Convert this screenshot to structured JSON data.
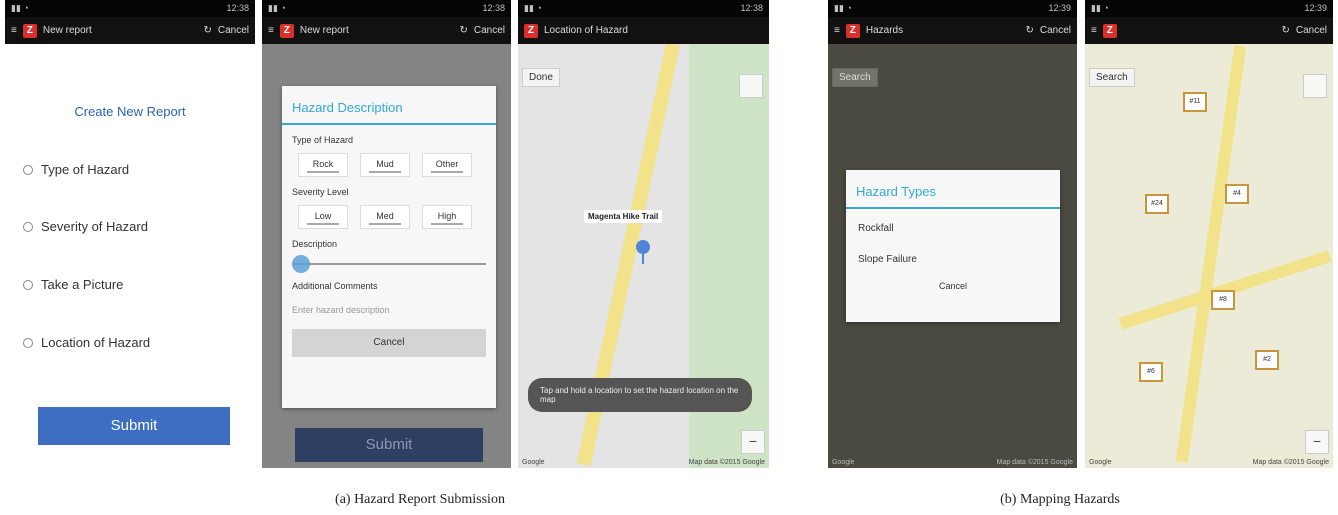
{
  "status_time": "12:38",
  "status_time_right": "12:39",
  "panels": [
    {
      "actionbar_title": "New report",
      "actionbar_right": "Cancel",
      "title": "Create New Report",
      "items": [
        "Type of Hazard",
        "Severity of Hazard",
        "Take a Picture",
        "Location of Hazard"
      ],
      "submit": "Submit"
    },
    {
      "actionbar_title": "New report",
      "actionbar_right": "Cancel",
      "dialog_title": "Hazard Description",
      "hazard_type_label": "Type of Hazard",
      "hazard_types": [
        "Rock",
        "Mud",
        "Other"
      ],
      "severity_label": "Severity Level",
      "severity_options": [
        "Low",
        "Med",
        "High"
      ],
      "description_label": "Description",
      "slider_value": 0,
      "notes_label": "Additional Comments",
      "notes_placeholder": "Enter hazard description",
      "dialog_button": "Cancel",
      "submit": "Submit"
    },
    {
      "actionbar_title": "Location of Hazard",
      "map_button": "Done",
      "marker_label": "Magenta Hike Trail",
      "toast": "Tap and hold a location to set the hazard location on the map",
      "attribution": "Google",
      "map_data": "Map data ©2015 Google"
    },
    {
      "actionbar_title": "Hazards",
      "actionbar_right": "Cancel",
      "map_button": "Search",
      "dialog_title": "Hazard Types",
      "options": [
        "Rockfall",
        "Slope Failure"
      ],
      "dialog_button": "Cancel",
      "attribution": "Google",
      "map_data": "Map data ©2015 Google"
    },
    {
      "actionbar_right": "Cancel",
      "map_button": "Search",
      "markers": [
        "#11",
        "#24",
        "#4",
        "#8",
        "#6",
        "#2"
      ],
      "attribution": "Google",
      "map_data": "Map data ©2015 Google"
    }
  ],
  "captions": [
    "(a) Hazard Report Submission",
    "(b) Mapping Hazards"
  ],
  "colors": {
    "accent": "#33a8d8",
    "submit": "#3d6ec2",
    "marker": "#c8953f"
  }
}
